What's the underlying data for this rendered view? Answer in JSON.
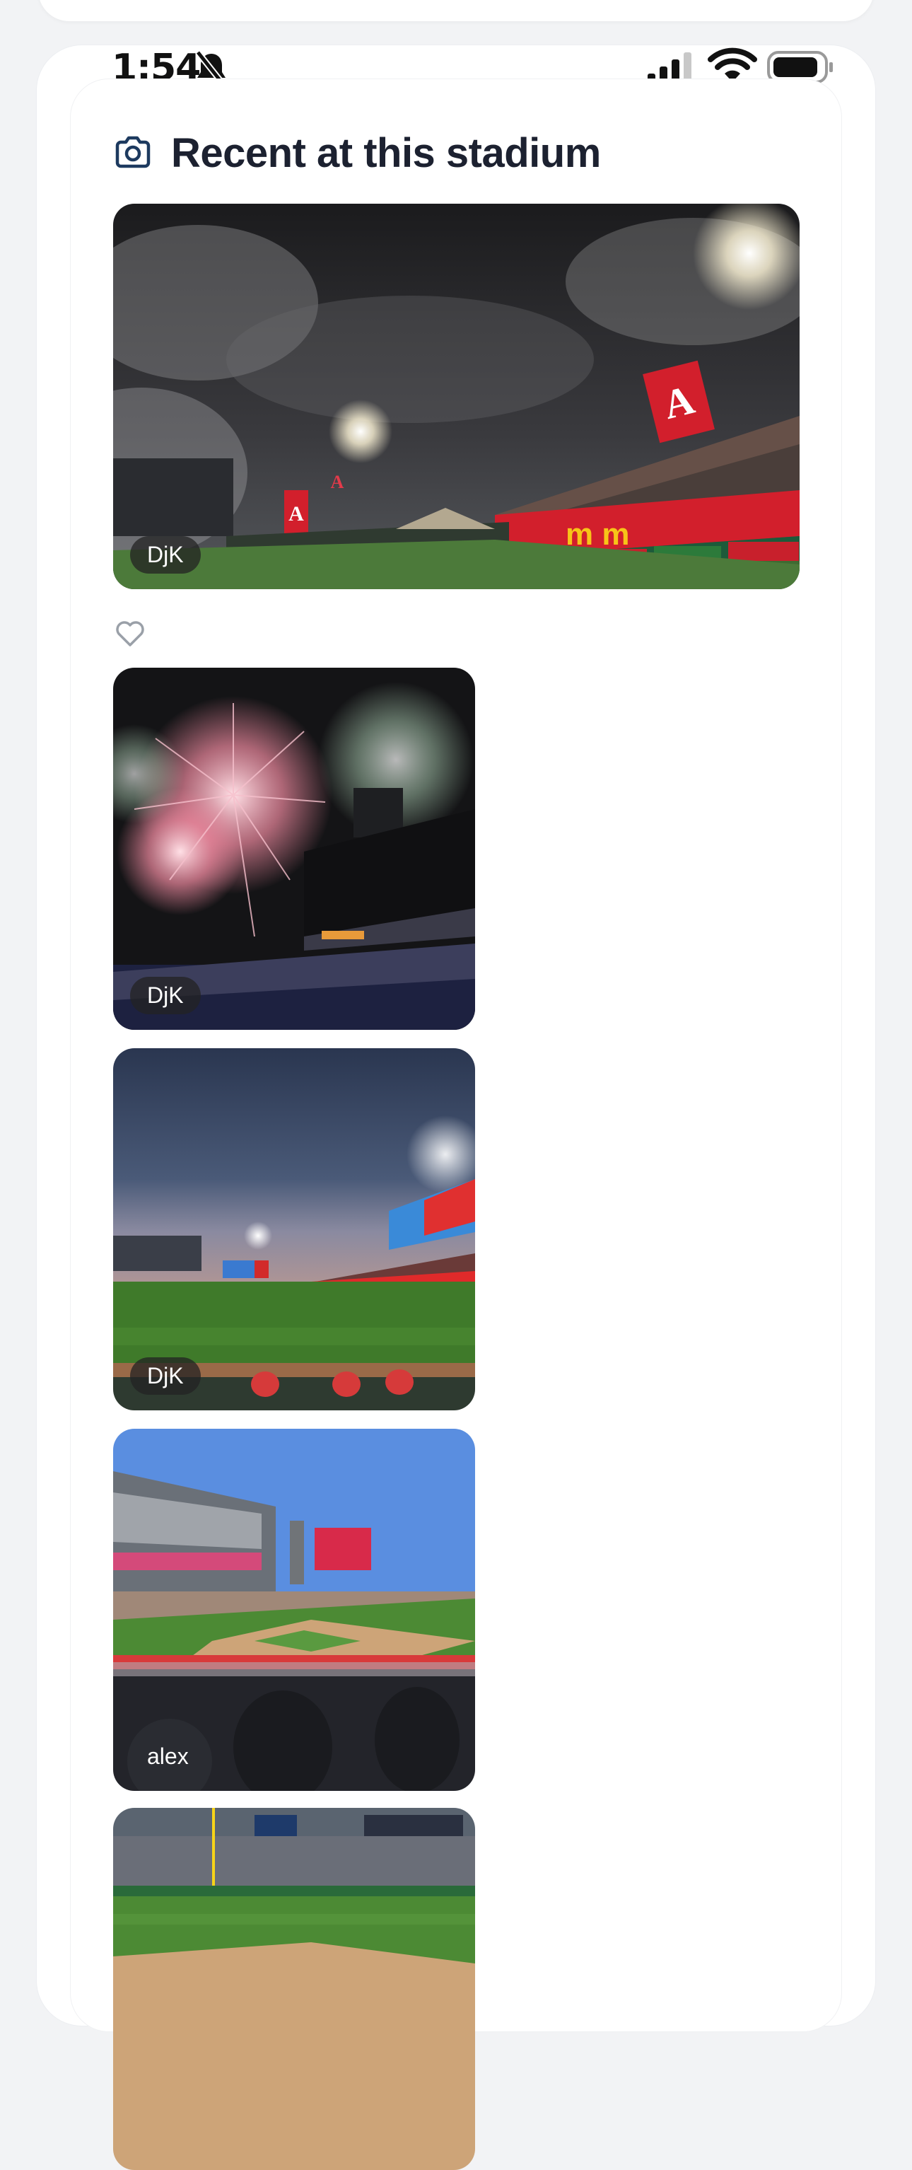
{
  "status_bar": {
    "time": "1:54",
    "icons": [
      "bell-slash-icon",
      "cellular-signal-icon",
      "wifi-icon",
      "battery-icon"
    ]
  },
  "section": {
    "icon": "camera-icon",
    "title": "Recent at this stadium"
  },
  "photos": [
    {
      "author": "DjK",
      "scene": "fireworks smoke over stadium with angels signage"
    },
    {
      "author": "DjK",
      "scene": "fireworks display over scoreboard"
    },
    {
      "author": "DjK",
      "scene": "dusk view of outfield and scoreboard"
    },
    {
      "author": "alex",
      "scene": "day game view from seats behind dugout"
    },
    {
      "author": "",
      "scene": "day game view down left field line"
    }
  ],
  "like": {
    "icon": "heart-icon"
  },
  "colors": {
    "accent": "#1d3a5f",
    "angels_red": "#d21f2c",
    "background": "#f2f3f5"
  }
}
